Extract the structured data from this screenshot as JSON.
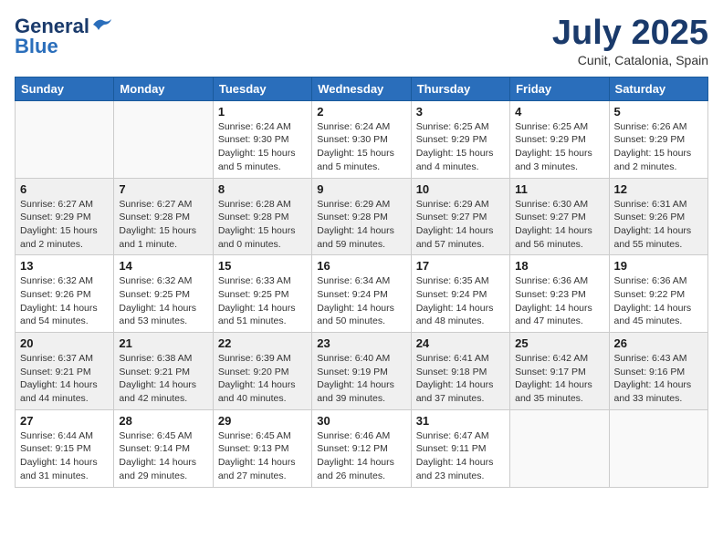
{
  "logo": {
    "line1": "General",
    "line2": "Blue"
  },
  "title": "July 2025",
  "subtitle": "Cunit, Catalonia, Spain",
  "weekdays": [
    "Sunday",
    "Monday",
    "Tuesday",
    "Wednesday",
    "Thursday",
    "Friday",
    "Saturday"
  ],
  "weeks": [
    [
      {
        "day": "",
        "info": ""
      },
      {
        "day": "",
        "info": ""
      },
      {
        "day": "1",
        "info": "Sunrise: 6:24 AM\nSunset: 9:30 PM\nDaylight: 15 hours\nand 5 minutes."
      },
      {
        "day": "2",
        "info": "Sunrise: 6:24 AM\nSunset: 9:30 PM\nDaylight: 15 hours\nand 5 minutes."
      },
      {
        "day": "3",
        "info": "Sunrise: 6:25 AM\nSunset: 9:29 PM\nDaylight: 15 hours\nand 4 minutes."
      },
      {
        "day": "4",
        "info": "Sunrise: 6:25 AM\nSunset: 9:29 PM\nDaylight: 15 hours\nand 3 minutes."
      },
      {
        "day": "5",
        "info": "Sunrise: 6:26 AM\nSunset: 9:29 PM\nDaylight: 15 hours\nand 2 minutes."
      }
    ],
    [
      {
        "day": "6",
        "info": "Sunrise: 6:27 AM\nSunset: 9:29 PM\nDaylight: 15 hours\nand 2 minutes."
      },
      {
        "day": "7",
        "info": "Sunrise: 6:27 AM\nSunset: 9:28 PM\nDaylight: 15 hours\nand 1 minute."
      },
      {
        "day": "8",
        "info": "Sunrise: 6:28 AM\nSunset: 9:28 PM\nDaylight: 15 hours\nand 0 minutes."
      },
      {
        "day": "9",
        "info": "Sunrise: 6:29 AM\nSunset: 9:28 PM\nDaylight: 14 hours\nand 59 minutes."
      },
      {
        "day": "10",
        "info": "Sunrise: 6:29 AM\nSunset: 9:27 PM\nDaylight: 14 hours\nand 57 minutes."
      },
      {
        "day": "11",
        "info": "Sunrise: 6:30 AM\nSunset: 9:27 PM\nDaylight: 14 hours\nand 56 minutes."
      },
      {
        "day": "12",
        "info": "Sunrise: 6:31 AM\nSunset: 9:26 PM\nDaylight: 14 hours\nand 55 minutes."
      }
    ],
    [
      {
        "day": "13",
        "info": "Sunrise: 6:32 AM\nSunset: 9:26 PM\nDaylight: 14 hours\nand 54 minutes."
      },
      {
        "day": "14",
        "info": "Sunrise: 6:32 AM\nSunset: 9:25 PM\nDaylight: 14 hours\nand 53 minutes."
      },
      {
        "day": "15",
        "info": "Sunrise: 6:33 AM\nSunset: 9:25 PM\nDaylight: 14 hours\nand 51 minutes."
      },
      {
        "day": "16",
        "info": "Sunrise: 6:34 AM\nSunset: 9:24 PM\nDaylight: 14 hours\nand 50 minutes."
      },
      {
        "day": "17",
        "info": "Sunrise: 6:35 AM\nSunset: 9:24 PM\nDaylight: 14 hours\nand 48 minutes."
      },
      {
        "day": "18",
        "info": "Sunrise: 6:36 AM\nSunset: 9:23 PM\nDaylight: 14 hours\nand 47 minutes."
      },
      {
        "day": "19",
        "info": "Sunrise: 6:36 AM\nSunset: 9:22 PM\nDaylight: 14 hours\nand 45 minutes."
      }
    ],
    [
      {
        "day": "20",
        "info": "Sunrise: 6:37 AM\nSunset: 9:21 PM\nDaylight: 14 hours\nand 44 minutes."
      },
      {
        "day": "21",
        "info": "Sunrise: 6:38 AM\nSunset: 9:21 PM\nDaylight: 14 hours\nand 42 minutes."
      },
      {
        "day": "22",
        "info": "Sunrise: 6:39 AM\nSunset: 9:20 PM\nDaylight: 14 hours\nand 40 minutes."
      },
      {
        "day": "23",
        "info": "Sunrise: 6:40 AM\nSunset: 9:19 PM\nDaylight: 14 hours\nand 39 minutes."
      },
      {
        "day": "24",
        "info": "Sunrise: 6:41 AM\nSunset: 9:18 PM\nDaylight: 14 hours\nand 37 minutes."
      },
      {
        "day": "25",
        "info": "Sunrise: 6:42 AM\nSunset: 9:17 PM\nDaylight: 14 hours\nand 35 minutes."
      },
      {
        "day": "26",
        "info": "Sunrise: 6:43 AM\nSunset: 9:16 PM\nDaylight: 14 hours\nand 33 minutes."
      }
    ],
    [
      {
        "day": "27",
        "info": "Sunrise: 6:44 AM\nSunset: 9:15 PM\nDaylight: 14 hours\nand 31 minutes."
      },
      {
        "day": "28",
        "info": "Sunrise: 6:45 AM\nSunset: 9:14 PM\nDaylight: 14 hours\nand 29 minutes."
      },
      {
        "day": "29",
        "info": "Sunrise: 6:45 AM\nSunset: 9:13 PM\nDaylight: 14 hours\nand 27 minutes."
      },
      {
        "day": "30",
        "info": "Sunrise: 6:46 AM\nSunset: 9:12 PM\nDaylight: 14 hours\nand 26 minutes."
      },
      {
        "day": "31",
        "info": "Sunrise: 6:47 AM\nSunset: 9:11 PM\nDaylight: 14 hours\nand 23 minutes."
      },
      {
        "day": "",
        "info": ""
      },
      {
        "day": "",
        "info": ""
      }
    ]
  ]
}
